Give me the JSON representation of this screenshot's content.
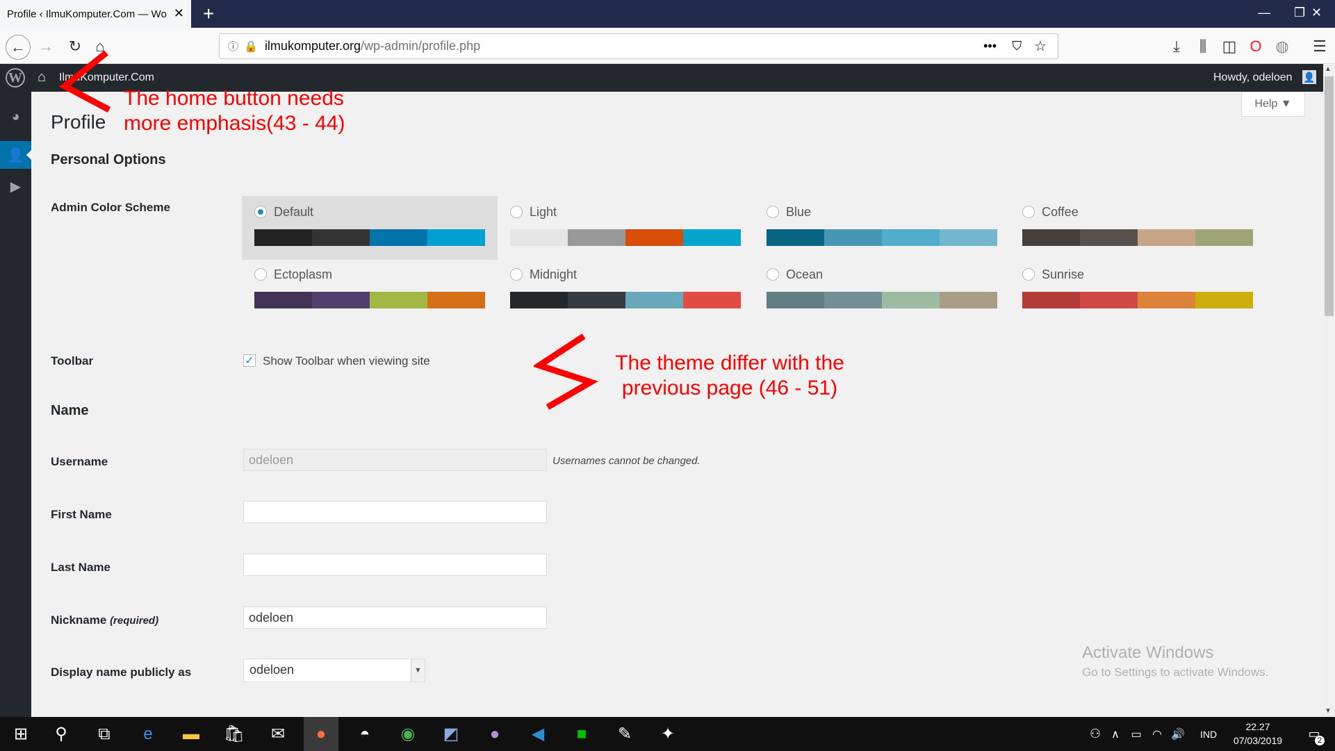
{
  "browser": {
    "tab_title": "Profile ‹ IlmuKomputer.Com — Wo",
    "url_domain": "ilmukomputer.org",
    "url_path": "/wp-admin/profile.php"
  },
  "adminbar": {
    "site_name": "IlmuKomputer.Com",
    "greeting": "Howdy, odeloen"
  },
  "page": {
    "title": "Profile",
    "help_label": "Help ▼",
    "personal_options": "Personal Options",
    "admin_color_scheme_label": "Admin Color Scheme",
    "schemes": [
      {
        "name": "Default",
        "selected": true,
        "colors": [
          "#222222",
          "#333333",
          "#0073aa",
          "#00a0d2"
        ]
      },
      {
        "name": "Light",
        "selected": false,
        "colors": [
          "#e5e5e5",
          "#999999",
          "#d64e07",
          "#04a4cc"
        ]
      },
      {
        "name": "Blue",
        "selected": false,
        "colors": [
          "#096484",
          "#4796b3",
          "#52accc",
          "#74b6ce"
        ]
      },
      {
        "name": "Coffee",
        "selected": false,
        "colors": [
          "#46403c",
          "#59524c",
          "#c7a589",
          "#9ea476"
        ]
      },
      {
        "name": "Ectoplasm",
        "selected": false,
        "colors": [
          "#413256",
          "#523f6d",
          "#a3b745",
          "#d46f15"
        ]
      },
      {
        "name": "Midnight",
        "selected": false,
        "colors": [
          "#25282b",
          "#363b3f",
          "#69a8bb",
          "#e14d43"
        ]
      },
      {
        "name": "Ocean",
        "selected": false,
        "colors": [
          "#627c83",
          "#738e96",
          "#9ebaa0",
          "#aa9d88"
        ]
      },
      {
        "name": "Sunrise",
        "selected": false,
        "colors": [
          "#b43c38",
          "#cf4944",
          "#dd823b",
          "#ccaf0b"
        ]
      }
    ],
    "toolbar_label": "Toolbar",
    "toolbar_checkbox": "Show Toolbar when viewing site",
    "name_heading": "Name",
    "username_label": "Username",
    "username_value": "odeloen",
    "username_note": "Usernames cannot be changed.",
    "first_name_label": "First Name",
    "last_name_label": "Last Name",
    "nickname_label": "Nickname",
    "nickname_required": "(required)",
    "nickname_value": "odeloen",
    "display_name_label": "Display name publicly as",
    "display_name_value": "odeloen"
  },
  "annotations": {
    "home": [
      "The home button needs",
      "more emphasis(43 - 44)"
    ],
    "theme": [
      "The theme differ with the",
      "previous page (46 - 51)"
    ],
    "color": "#ff0000"
  },
  "watermark": {
    "line1": "Activate Windows",
    "line2": "Go to Settings to activate Windows."
  },
  "taskbar": {
    "lang": "IND",
    "time": "22.27",
    "date": "07/03/2019",
    "notif_count": "2"
  }
}
